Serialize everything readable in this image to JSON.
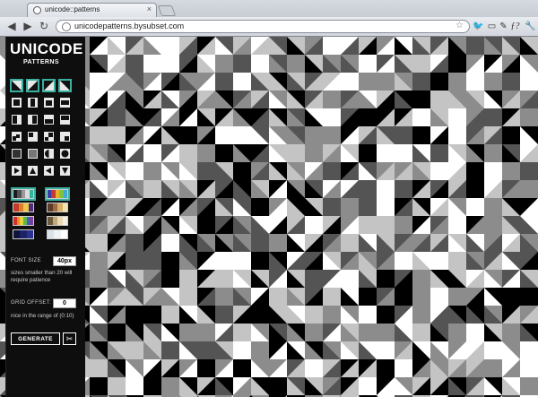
{
  "browser": {
    "tab_title": "unicode::patterns",
    "tab_close": "×",
    "url": "unicodepatterns.bysubset.com",
    "back_icon": "◀",
    "forward_icon": "▶",
    "reload_icon": "↻",
    "star_icon": "☆",
    "toolbar_icons": [
      "twitter-icon",
      "feed-icon",
      "mail-icon",
      "info-icon",
      "pen-icon",
      "function-icon",
      "wrench-icon"
    ],
    "toolbar_glyphs": [
      "🐦",
      "▭",
      "✉",
      "ℹ",
      "✎",
      "ƒ?",
      "🔧"
    ]
  },
  "panel": {
    "title": "UNICODE",
    "subtitle": "PATTERNS",
    "font_size_label": "FONT SIZE",
    "font_size_value": "40px",
    "font_size_note": "sizes smaller than 20 will require patience",
    "grid_offset_label": "GRID OFFSET:",
    "grid_offset_value": "0",
    "grid_offset_note": "nice in the range of (0:10)",
    "generate_label": "GENERATE",
    "scissors_icon": "✂"
  },
  "glyph_buttons": [
    {
      "icon": "triangle-lower-left-icon",
      "selected": true
    },
    {
      "icon": "triangle-lower-right-icon",
      "selected": true
    },
    {
      "icon": "triangle-upper-left-icon",
      "selected": true
    },
    {
      "icon": "triangle-upper-right-icon",
      "selected": true
    },
    {
      "icon": "block-full-icon",
      "selected": false
    },
    {
      "icon": "block-tall-icon",
      "selected": false
    },
    {
      "icon": "block-medium-icon",
      "selected": false
    },
    {
      "icon": "block-wide-icon",
      "selected": false
    },
    {
      "icon": "block-left-icon",
      "selected": false
    },
    {
      "icon": "block-right-icon",
      "selected": false
    },
    {
      "icon": "block-lower-icon",
      "selected": false
    },
    {
      "icon": "block-upper-icon",
      "selected": false
    },
    {
      "icon": "quadrant-lower-left-icon",
      "selected": false
    },
    {
      "icon": "quadrant-upper-left-icon",
      "selected": false
    },
    {
      "icon": "quadrant-right-icon",
      "selected": false
    },
    {
      "icon": "quadrant-lower-right-icon",
      "selected": false
    },
    {
      "icon": "dark-shade-icon",
      "selected": false
    },
    {
      "icon": "medium-shade-icon",
      "selected": false
    },
    {
      "icon": "half-circle-icon",
      "selected": false
    },
    {
      "icon": "circle-icon",
      "selected": false
    },
    {
      "icon": "play-right-icon",
      "selected": false
    },
    {
      "icon": "play-up-icon",
      "selected": false
    },
    {
      "icon": "play-left-icon",
      "selected": false
    },
    {
      "icon": "play-down-icon",
      "selected": false
    }
  ],
  "palettes": [
    {
      "name": "grayscale-teal-palette",
      "selected": true,
      "colors": [
        "#1b1b1b",
        "#555",
        "#999",
        "#ddd",
        "#2fb59e"
      ]
    },
    {
      "name": "rainbow-palette",
      "selected": true,
      "colors": [
        "#3a3fa8",
        "#c0393b",
        "#e8b322",
        "#7dc243",
        "#40a9d6"
      ]
    },
    {
      "name": "sunset-palette",
      "selected": false,
      "colors": [
        "#c43a2d",
        "#e07d2a",
        "#f0c64a",
        "#4e2e7a"
      ]
    },
    {
      "name": "earth-palette",
      "selected": false,
      "colors": [
        "#5b3b2a",
        "#9c6b3f",
        "#d8b067",
        "#f3e2b1"
      ]
    },
    {
      "name": "spectrum-palette",
      "selected": false,
      "colors": [
        "#d2312a",
        "#ea8b25",
        "#e9d33a",
        "#5fb54c",
        "#3d63b3",
        "#7c3c9b"
      ]
    },
    {
      "name": "sand-palette",
      "selected": false,
      "colors": [
        "#6b5a3e",
        "#c2a879",
        "#ead9b5",
        "#f7f0de"
      ]
    },
    {
      "name": "navy-palette",
      "selected": false,
      "colors": [
        "#10133a",
        "#1d2367",
        "#2b3191"
      ]
    },
    {
      "name": "ice-palette",
      "selected": false,
      "colors": [
        "#d9e2e8",
        "#eef2f5",
        "#ffffff"
      ]
    }
  ],
  "pattern_colors": [
    "#000000",
    "#ffffff",
    "#545454",
    "#8c8c8c",
    "#c4c4c4"
  ]
}
